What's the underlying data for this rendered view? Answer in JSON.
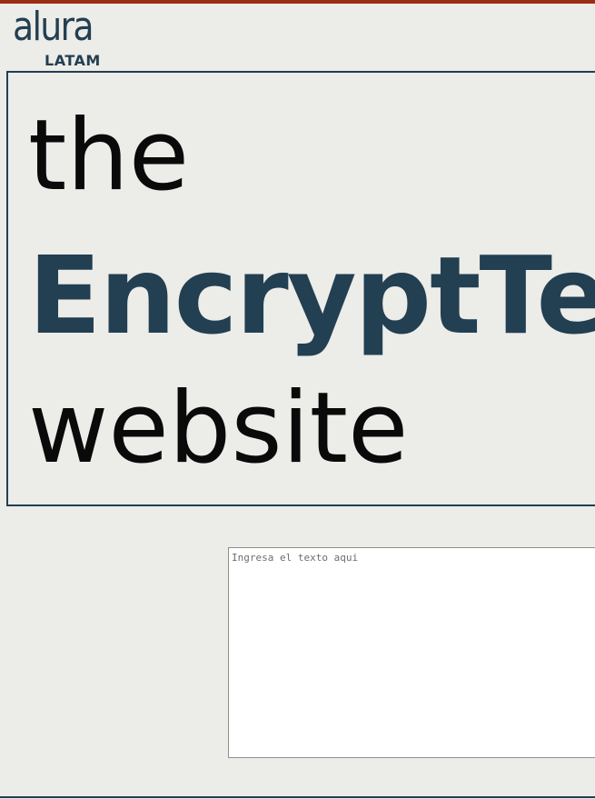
{
  "header": {
    "logo_main": "alura",
    "logo_sub": "LATAM"
  },
  "hero": {
    "line1": "the",
    "line2": "EncryptText",
    "line3": "website"
  },
  "input": {
    "placeholder": "Ingresa el texto aqui",
    "value": ""
  },
  "colors": {
    "brand": "#233f52",
    "background": "#ecece8",
    "top_strip": "#9a2e12"
  }
}
